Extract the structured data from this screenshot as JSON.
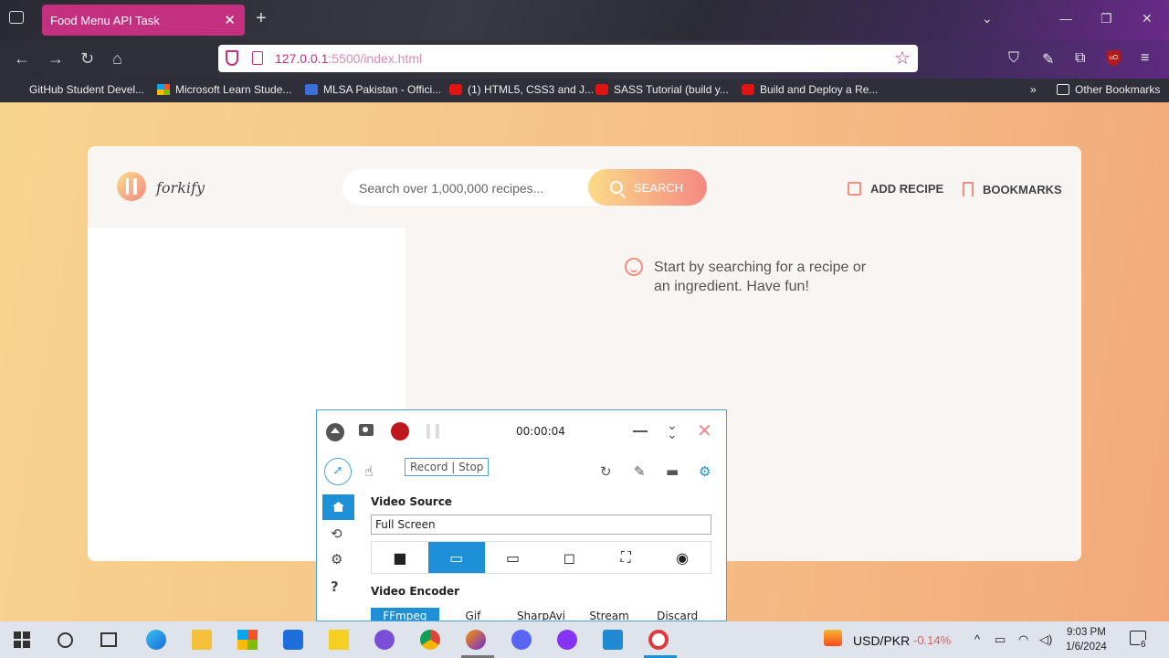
{
  "browser": {
    "tab_title": "Food Menu API Task",
    "tab_close": "✕",
    "new_tab": "+",
    "url_host": "127.0.0.1",
    "url_rest": ":5500/index.html",
    "bookmarks": [
      "GitHub Student Devel...",
      "Microsoft Learn Stude...",
      "MLSA Pakistan - Offici...",
      "(1) HTML5, CSS3 and J...",
      "SASS Tutorial (build y...",
      "Build and Deploy a Re..."
    ],
    "other_bookmarks": "Other Bookmarks"
  },
  "app": {
    "logo": "forkify",
    "search_placeholder": "Search over 1,000,000 recipes...",
    "search_button": "SEARCH",
    "add_recipe": "ADD RECIPE",
    "bookmarks": "BOOKMARKS",
    "message": "Start by searching for a recipe or an ingredient. Have fun!"
  },
  "recorder": {
    "timer": "00:00:04",
    "tooltip": "Record | Stop",
    "video_source_label": "Video Source",
    "video_source_value": "Full Screen",
    "video_encoder_label": "Video Encoder",
    "encoders": [
      "FFmpeg",
      "Gif",
      "SharpAvi",
      "Stream",
      "Discard"
    ],
    "active_encoder": "FFmpeg",
    "accent": "#1e90d8"
  },
  "taskbar": {
    "currency": "USD/PKR",
    "change": "-0.14%",
    "time": "9:03 PM",
    "date": "1/6/2024",
    "notifications": "6"
  },
  "colors": {
    "tab": "#c2307f",
    "brand_gradient_start": "#fbdb89",
    "brand_gradient_end": "#f48982"
  }
}
